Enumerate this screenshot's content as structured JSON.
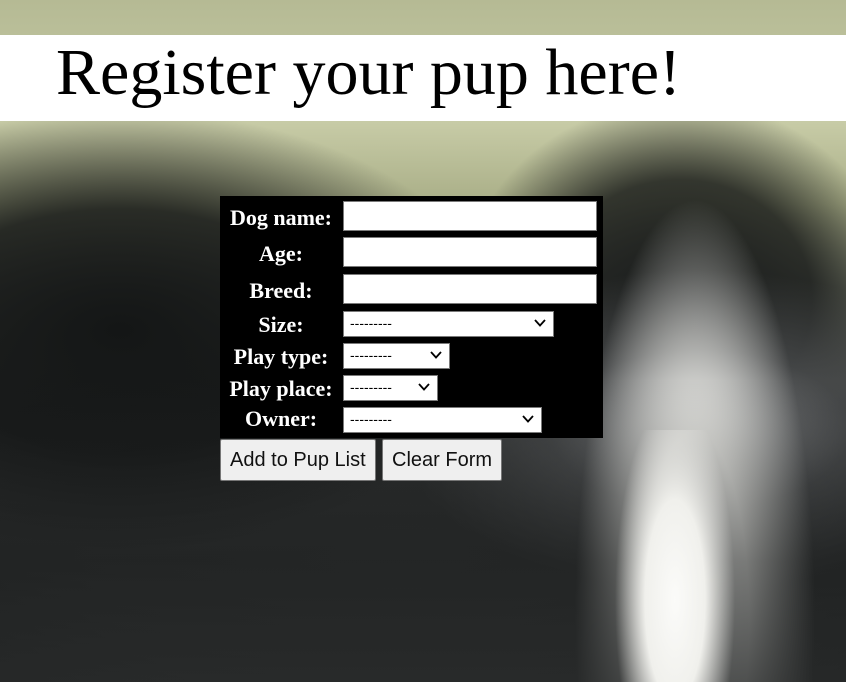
{
  "header": {
    "title": "Register your pup here!"
  },
  "form": {
    "dog_name": {
      "label": "Dog name:",
      "value": ""
    },
    "age": {
      "label": "Age:",
      "value": ""
    },
    "breed": {
      "label": "Breed:",
      "value": ""
    },
    "size": {
      "label": "Size:",
      "selected": "---------"
    },
    "play_type": {
      "label": "Play type:",
      "selected": "---------"
    },
    "play_place": {
      "label": "Play place:",
      "selected": "---------"
    },
    "owner": {
      "label": "Owner:",
      "selected": "---------"
    }
  },
  "buttons": {
    "add": "Add to Pup List",
    "clear": "Clear Form"
  },
  "icons": {
    "dropdown": "chevron-down-icon"
  }
}
